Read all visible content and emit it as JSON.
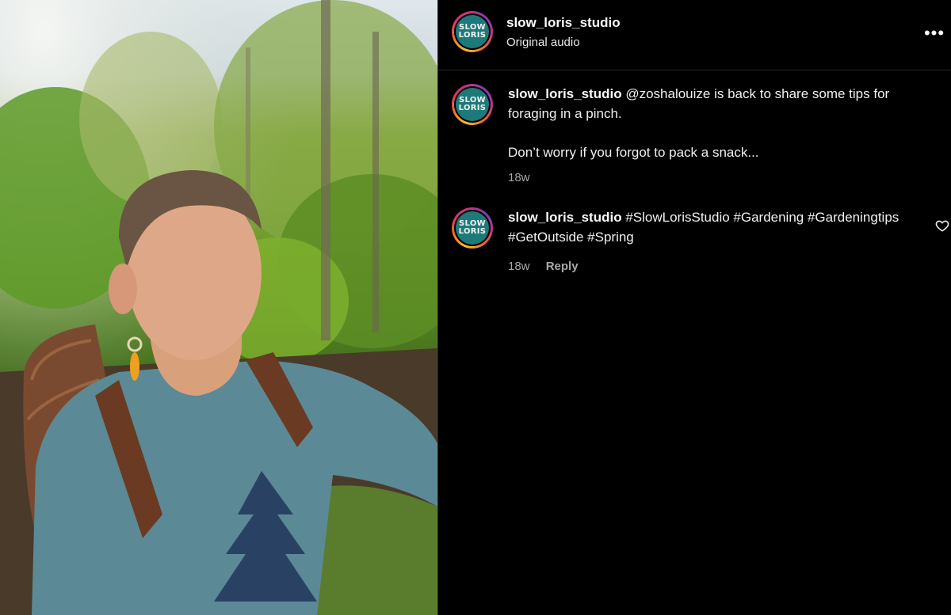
{
  "post": {
    "username": "slow_loris_studio",
    "audio": "Original audio",
    "avatar_text_top": "SLOW",
    "avatar_text_bottom": "LORIS"
  },
  "comments": [
    {
      "username": "slow_loris_studio",
      "text": "@zoshalouize is back to share some tips for foraging in a pinch.",
      "text2": "Don’t worry if you forgot to pack a snack...",
      "time": "18w"
    },
    {
      "username": "slow_loris_studio",
      "text": "#SlowLorisStudio #Gardening #Gardeningtips #GetOutside #Spring",
      "time": "18w",
      "reply_label": "Reply"
    }
  ],
  "icons": {
    "more": "more-options-icon",
    "like": "heart-icon"
  },
  "colors": {
    "background": "#000000",
    "avatar_bg": "#1e7a7a",
    "meta_text": "#a8a8a8"
  }
}
